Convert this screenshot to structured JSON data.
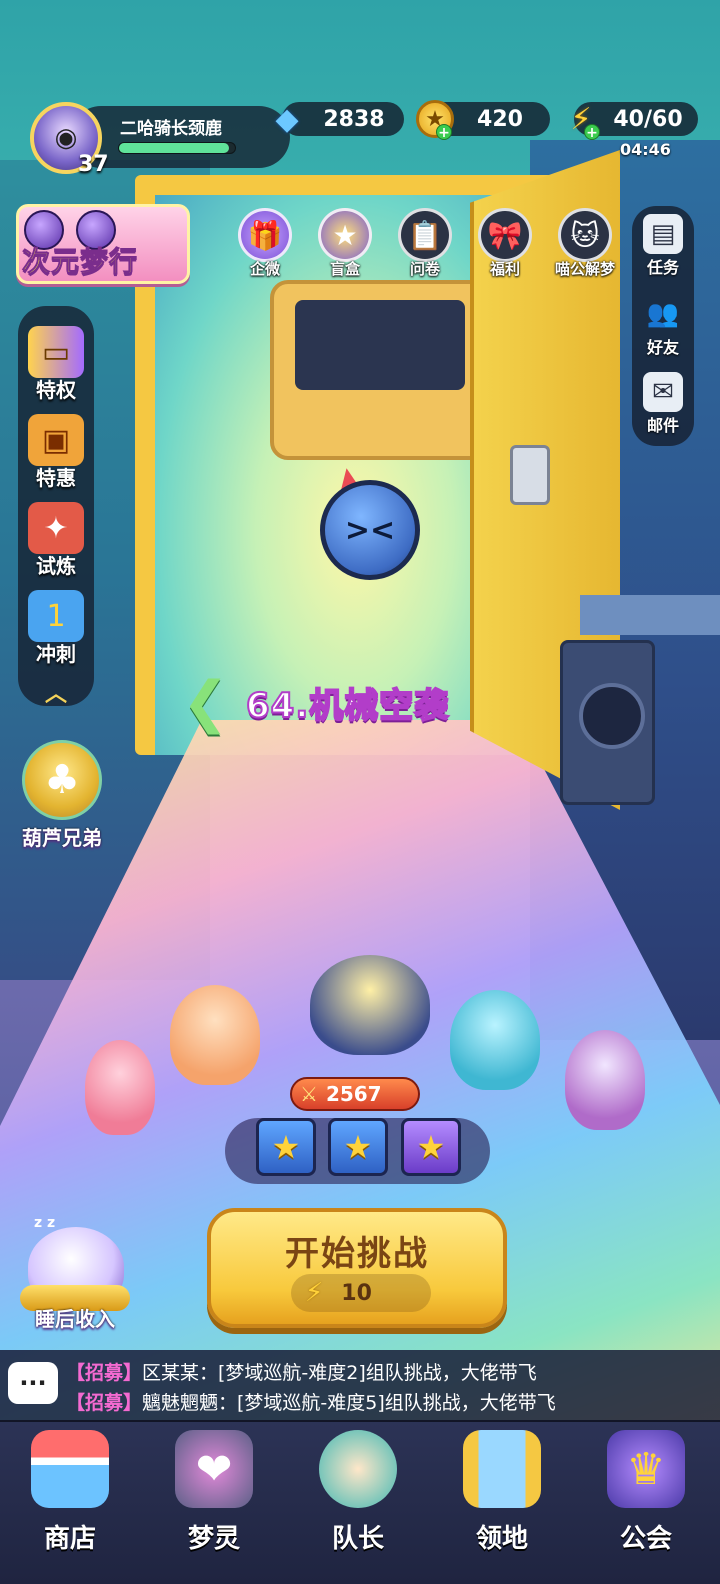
{
  "player": {
    "name": "二哈骑长颈鹿",
    "level": "37",
    "exp_fraction": 0.95
  },
  "resources": {
    "diamonds": "2838",
    "coins": "420",
    "energy": "40/60",
    "energy_timer": "04:46"
  },
  "event_banner": {
    "title": "次元梦行"
  },
  "top_icons": [
    {
      "label": "企微",
      "icon": "gift-icon"
    },
    {
      "label": "盲盒",
      "icon": "mystery-box-icon"
    },
    {
      "label": "问卷",
      "icon": "clipboard-icon"
    },
    {
      "label": "福利",
      "icon": "welfare-gift-icon"
    },
    {
      "label": "喵公解梦",
      "icon": "cat-icon"
    }
  ],
  "right_menu": [
    {
      "label": "任务",
      "icon": "task-book-icon"
    },
    {
      "label": "好友",
      "icon": "friends-icon"
    },
    {
      "label": "邮件",
      "icon": "mail-icon"
    }
  ],
  "left_menu": [
    {
      "label": "特权",
      "icon": "privilege-card-icon"
    },
    {
      "label": "特惠",
      "icon": "discount-box-icon"
    },
    {
      "label": "试炼",
      "icon": "trial-cannon-icon"
    },
    {
      "label": "冲刺",
      "icon": "sprint-rank-icon"
    }
  ],
  "gourd": {
    "label": "葫芦兄弟"
  },
  "stage": {
    "title": "64.机械空袭"
  },
  "team": {
    "power": "2567"
  },
  "start": {
    "label": "开始挑战",
    "cost": "10"
  },
  "sleep_income": {
    "label": "睡后收入",
    "zzz": "z z"
  },
  "chat": [
    {
      "tag": "【招募】",
      "message": "区某某：[梦域巡航-难度2]组队挑战，大佬带飞"
    },
    {
      "tag": "【招募】",
      "message": "魑魅魍魉：[梦域巡航-难度5]组队挑战，大佬带飞"
    }
  ],
  "bottom_nav": [
    {
      "label": "商店",
      "icon": "shop-icon"
    },
    {
      "label": "梦灵",
      "icon": "dream-spirit-icon"
    },
    {
      "label": "队长",
      "icon": "captain-icon"
    },
    {
      "label": "领地",
      "icon": "territory-door-icon"
    },
    {
      "label": "公会",
      "icon": "guild-icon"
    }
  ],
  "colors": {
    "accent_gold": "#f8c93c",
    "stage_title_stroke": "#b23dc9",
    "chat_tag": "#f46ad1",
    "exp_bar": "#5fe39a"
  }
}
